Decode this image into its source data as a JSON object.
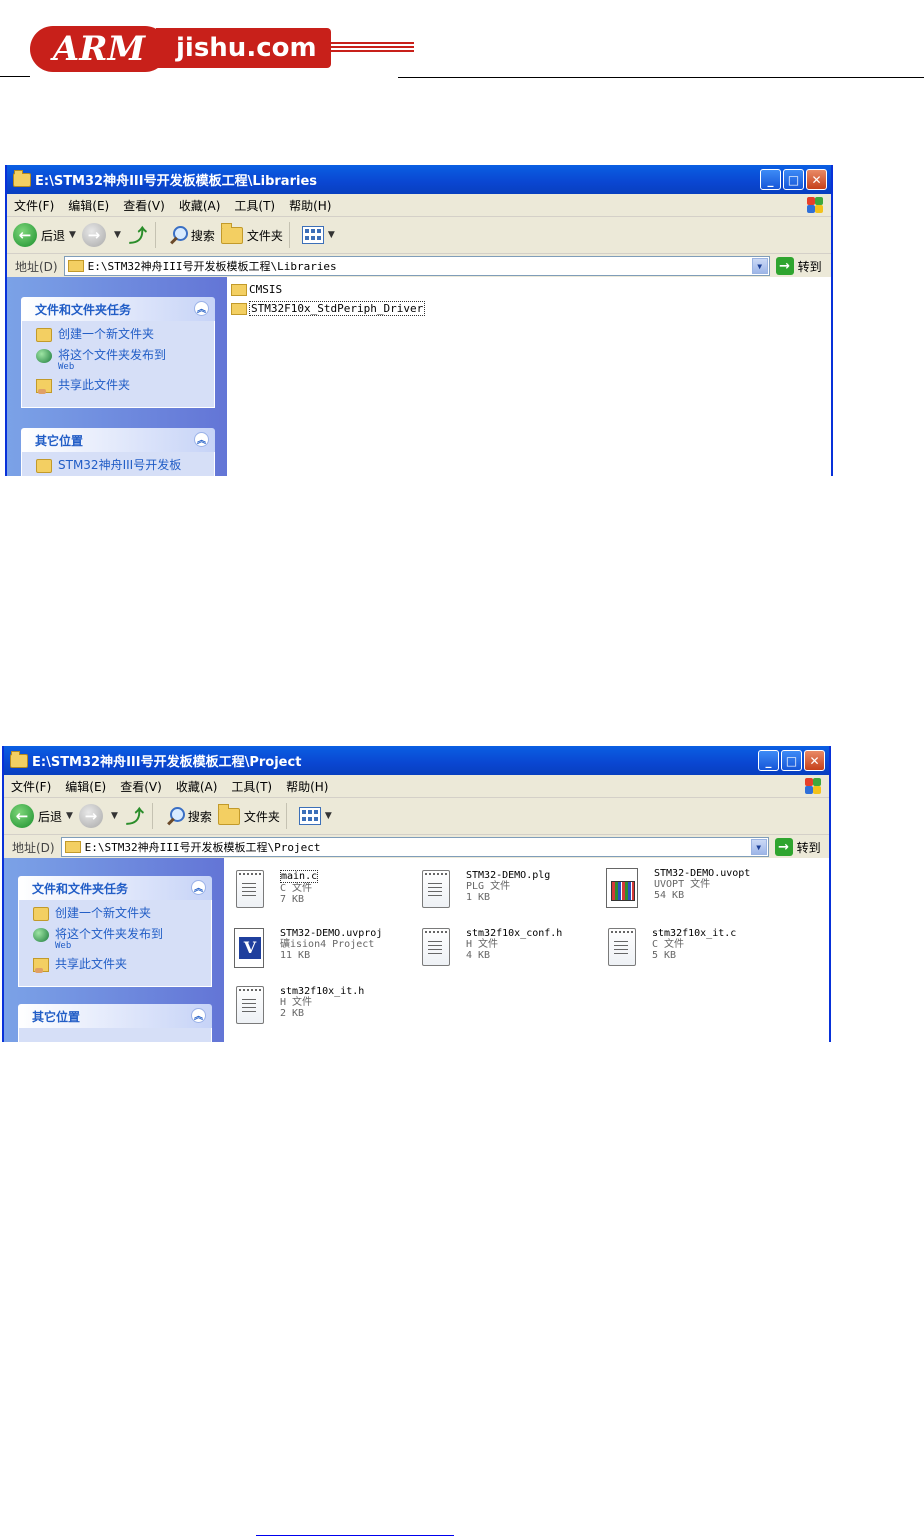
{
  "header": {
    "logo_badge": "ARM",
    "logo_text": "jishu.com"
  },
  "window1": {
    "title": "E:\\STM32神舟III号开发板模板工程\\Libraries",
    "address": "E:\\STM32神舟III号开发板模板工程\\Libraries",
    "files": [
      {
        "name": "CMSIS",
        "selected": false
      },
      {
        "name": "STM32F10x_StdPeriph_Driver",
        "selected": true
      }
    ],
    "other_places_first": "STM32神舟III号开发板"
  },
  "window2": {
    "title": "E:\\STM32神舟III号开发板模板工程\\Project",
    "address": "E:\\STM32神舟III号开发板模板工程\\Project",
    "tiles": [
      {
        "icon": "c-file",
        "name": "main.c",
        "type": "C 文件",
        "size": "7 KB"
      },
      {
        "icon": "plg-file",
        "name": "STM32-DEMO.plg",
        "type": "PLG 文件",
        "size": "1 KB"
      },
      {
        "icon": "uvopt-file",
        "name": "STM32-DEMO.uvopt",
        "type": "UVOPT 文件",
        "size": "54 KB"
      },
      {
        "icon": "uvproj-file",
        "name": "STM32-DEMO.uvproj",
        "type": "礦ision4 Project",
        "size": "11 KB"
      },
      {
        "icon": "h-file",
        "name": "stm32f10x_conf.h",
        "type": "H 文件",
        "size": "4 KB"
      },
      {
        "icon": "c-file",
        "name": "stm32f10x_it.c",
        "type": "C 文件",
        "size": "5 KB"
      },
      {
        "icon": "h-file",
        "name": "stm32f10x_it.h",
        "type": "H 文件",
        "size": "2 KB"
      }
    ]
  },
  "menu": {
    "file": "文件(F)",
    "edit": "编辑(E)",
    "view": "查看(V)",
    "favorites": "收藏(A)",
    "tools": "工具(T)",
    "help": "帮助(H)"
  },
  "toolbar": {
    "back": "后退",
    "search": "搜索",
    "folders": "文件夹"
  },
  "addressbar": {
    "label": "地址(D)",
    "go": "转到"
  },
  "taskpane": {
    "tasks_title": "文件和文件夹任务",
    "task_new_folder": "创建一个新文件夹",
    "task_publish": "将这个文件夹发布到",
    "task_publish_sub": "Web",
    "task_share": "共享此文件夹",
    "other_title": "其它位置"
  },
  "colors": {
    "titlebar": "#0a46d1",
    "taskpane": "#6f8be0",
    "link": "#215dc6"
  }
}
